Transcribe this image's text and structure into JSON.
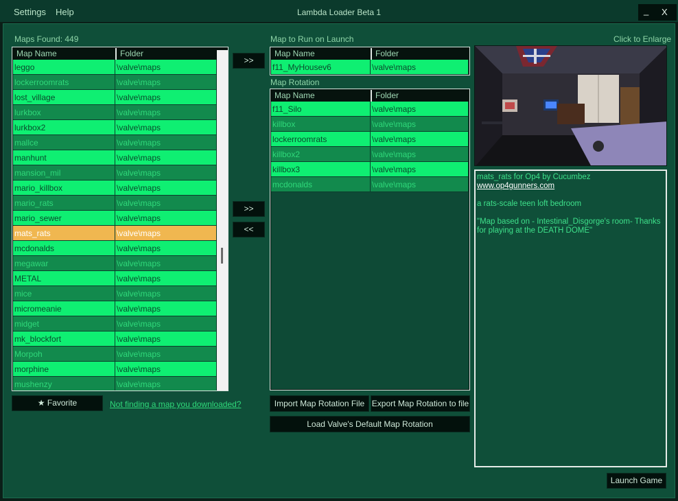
{
  "menu": {
    "settings": "Settings",
    "help": "Help"
  },
  "window": {
    "title": "Lambda Loader Beta 1",
    "minimize": "_",
    "close": "X"
  },
  "maps": {
    "found_label": "Maps Found: 449",
    "columns": [
      "Map Name",
      "Folder"
    ],
    "rows": [
      {
        "name": "leggo",
        "folder": "\\valve\\maps",
        "state": "on"
      },
      {
        "name": "lockerroomrats",
        "folder": "\\valve\\maps",
        "state": "off"
      },
      {
        "name": "lost_village",
        "folder": "\\valve\\maps",
        "state": "on"
      },
      {
        "name": "lurkbox",
        "folder": "\\valve\\maps",
        "state": "off"
      },
      {
        "name": "lurkbox2",
        "folder": "\\valve\\maps",
        "state": "on"
      },
      {
        "name": "mallce",
        "folder": "\\valve\\maps",
        "state": "off"
      },
      {
        "name": "manhunt",
        "folder": "\\valve\\maps",
        "state": "on"
      },
      {
        "name": "mansion_mil",
        "folder": "\\valve\\maps",
        "state": "off"
      },
      {
        "name": "mario_killbox",
        "folder": "\\valve\\maps",
        "state": "on"
      },
      {
        "name": "mario_rats",
        "folder": "\\valve\\maps",
        "state": "off"
      },
      {
        "name": "mario_sewer",
        "folder": "\\valve\\maps",
        "state": "on"
      },
      {
        "name": "mats_rats",
        "folder": "\\valve\\maps",
        "state": "sel"
      },
      {
        "name": "mcdonalds",
        "folder": "\\valve\\maps",
        "state": "on"
      },
      {
        "name": "megawar",
        "folder": "\\valve\\maps",
        "state": "off"
      },
      {
        "name": "METAL",
        "folder": "\\valve\\maps",
        "state": "on"
      },
      {
        "name": "mice",
        "folder": "\\valve\\maps",
        "state": "off"
      },
      {
        "name": "micromeanie",
        "folder": "\\valve\\maps",
        "state": "on"
      },
      {
        "name": "midget",
        "folder": "\\valve\\maps",
        "state": "off"
      },
      {
        "name": "mk_blockfort",
        "folder": "\\valve\\maps",
        "state": "on"
      },
      {
        "name": "Morpoh",
        "folder": "\\valve\\maps",
        "state": "off"
      },
      {
        "name": "morphine",
        "folder": "\\valve\\maps",
        "state": "on"
      },
      {
        "name": "mushenzy",
        "folder": "\\valve\\maps",
        "state": "off"
      }
    ]
  },
  "launch": {
    "label": "Map to Run on Launch",
    "columns": [
      "Map Name",
      "Folder"
    ],
    "rows": [
      {
        "name": "f11_MyHousev6",
        "folder": "\\valve\\maps",
        "state": "on"
      }
    ]
  },
  "rotation": {
    "label": "Map Rotation",
    "columns": [
      "Map Name",
      "Folder"
    ],
    "rows": [
      {
        "name": "f11_Silo",
        "folder": "\\valve\\maps",
        "state": "on"
      },
      {
        "name": "killbox",
        "folder": "\\valve\\maps",
        "state": "off"
      },
      {
        "name": "lockerroomrats",
        "folder": "\\valve\\maps",
        "state": "on"
      },
      {
        "name": "killbox2",
        "folder": "\\valve\\maps",
        "state": "off"
      },
      {
        "name": "killbox3",
        "folder": "\\valve\\maps",
        "state": "on"
      },
      {
        "name": "mcdonalds",
        "folder": "\\valve\\maps",
        "state": "off"
      }
    ]
  },
  "buttons": {
    "to_launch": ">>",
    "to_rotation": ">>",
    "from_rotation": "<<",
    "favorite": "★ Favorite",
    "import": "Import Map Rotation File",
    "export": "Export Map Rotation to file",
    "load_default": "Load Valve's Default Map Rotation",
    "launch_game": "Launch Game"
  },
  "links": {
    "not_finding": "Not finding a map you downloaded?"
  },
  "preview": {
    "click_hint": "Click to Enlarge"
  },
  "description": {
    "line1": "mats_rats for Op4 by Cucumbez ",
    "url": "www.op4gunners.com",
    "line2": "a rats-scale teen loft bedroom",
    "line3": "\"Map based on - Intestinal_Disgorge's room- Thanks for playing at the DEATH DOME\""
  }
}
